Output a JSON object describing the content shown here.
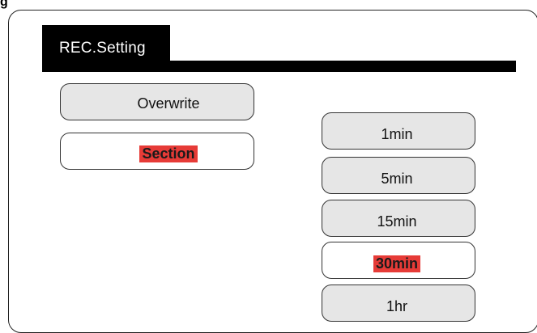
{
  "figure_letter": "g",
  "header": {
    "title": "REC.Setting"
  },
  "modes": {
    "overwrite": "Overwrite",
    "section": "Section",
    "selected": "Section"
  },
  "durations": {
    "options": [
      "1min",
      "5min",
      "15min",
      "30min",
      "1hr"
    ],
    "selected": "30min"
  },
  "colors": {
    "header_bg": "#000000",
    "header_text": "#ffffff",
    "button_bg": "#e6e6e6",
    "selected_bg": "#ffffff",
    "selected_highlight": "#e63b37"
  }
}
